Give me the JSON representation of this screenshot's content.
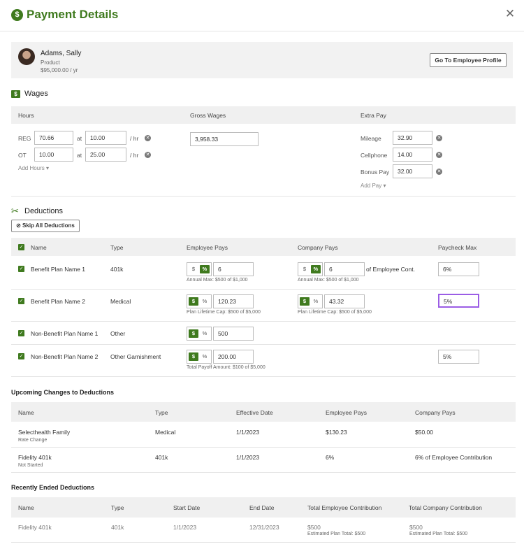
{
  "header": {
    "title": "Payment Details",
    "icon": "dollar-circle-icon",
    "close_icon": "close-icon"
  },
  "employee": {
    "name": "Adams, Sally",
    "department": "Product",
    "salary": "$95,000.00 / yr",
    "profile_button": "Go To Employee Profile"
  },
  "wages": {
    "title": "Wages",
    "col_hours": "Hours",
    "col_gross": "Gross Wages",
    "col_extra": "Extra Pay",
    "reg_label": "REG",
    "reg_hours": "70.66",
    "reg_at": "at",
    "reg_rate": "10.00",
    "reg_unit": "/ hr",
    "ot_label": "OT",
    "ot_hours": "10.00",
    "ot_at": "at",
    "ot_rate": "25.00",
    "ot_unit": "/ hr",
    "add_hours": "Add Hours",
    "gross": "3,958.33",
    "mileage_label": "Mileage",
    "mileage": "32.90",
    "cell_label": "Cellphone",
    "cell": "14.00",
    "bonus_label": "Bonus Pay",
    "bonus": "32.00",
    "add_pay": "Add Pay"
  },
  "deductions": {
    "title": "Deductions",
    "skip_button": "Skip All Deductions",
    "col_name": "Name",
    "col_type": "Type",
    "col_emp": "Employee Pays",
    "col_comp": "Company Pays",
    "col_max": "Paycheck Max",
    "rows": [
      {
        "name": "Benefit Plan Name 1",
        "type": "401k",
        "emp": "6",
        "emp_note": "Annual Max: $500 of $1,000",
        "comp": "6",
        "comp_suffix": "of Employee Cont.",
        "comp_note": "Annual Max: $500 of $1,000",
        "max": "6%"
      },
      {
        "name": "Benefit Plan Name 2",
        "type": "Medical",
        "emp": "120.23",
        "emp_note": "Plan Lifetime Cap: $500 of $5,000",
        "comp": "43.32",
        "comp_note": "Plan Lifetime Cap: $500 of $5,000",
        "max": "5%"
      },
      {
        "name": "Non-Benefit Plan Name 1",
        "type": "Other",
        "emp": "500"
      },
      {
        "name": "Non-Benefit Plan Name 2",
        "type": "Other Garnishment",
        "emp": "200.00",
        "emp_note": "Total Payoff Amount: $100 of $5,000",
        "max": "5%"
      }
    ],
    "dollar": "$",
    "percent": "%"
  },
  "upcoming": {
    "title": "Upcoming Changes to Deductions",
    "cols": [
      "Name",
      "Type",
      "Effective Date",
      "Employee Pays",
      "Company Pays"
    ],
    "rows": [
      {
        "name": "Selecthealth Family",
        "status": "Rate Change",
        "type": "Medical",
        "date": "1/1/2023",
        "emp": "$130.23",
        "comp": "$50.00"
      },
      {
        "name": "Fidelity 401k",
        "status": "Not Started",
        "type": "401k",
        "date": "1/1/2023",
        "emp": "6%",
        "comp": "6% of Employee Contribution"
      }
    ]
  },
  "ended": {
    "title": "Recently Ended Deductions",
    "cols": [
      "Name",
      "Type",
      "Start Date",
      "End Date",
      "Total Employee Contribution",
      "Total Company Contribution"
    ],
    "rows": [
      {
        "name": "Fidelity 401k",
        "type": "401k",
        "start": "1/1/2023",
        "end": "12/31/2023",
        "emp": "$500",
        "emp_note": "Estimated Plan Total: $500",
        "comp": "$500",
        "comp_note": "Estimated Plan Total: $500"
      }
    ]
  },
  "colors": {
    "accent": "#3f7a1e",
    "focus": "#9b5de5"
  }
}
